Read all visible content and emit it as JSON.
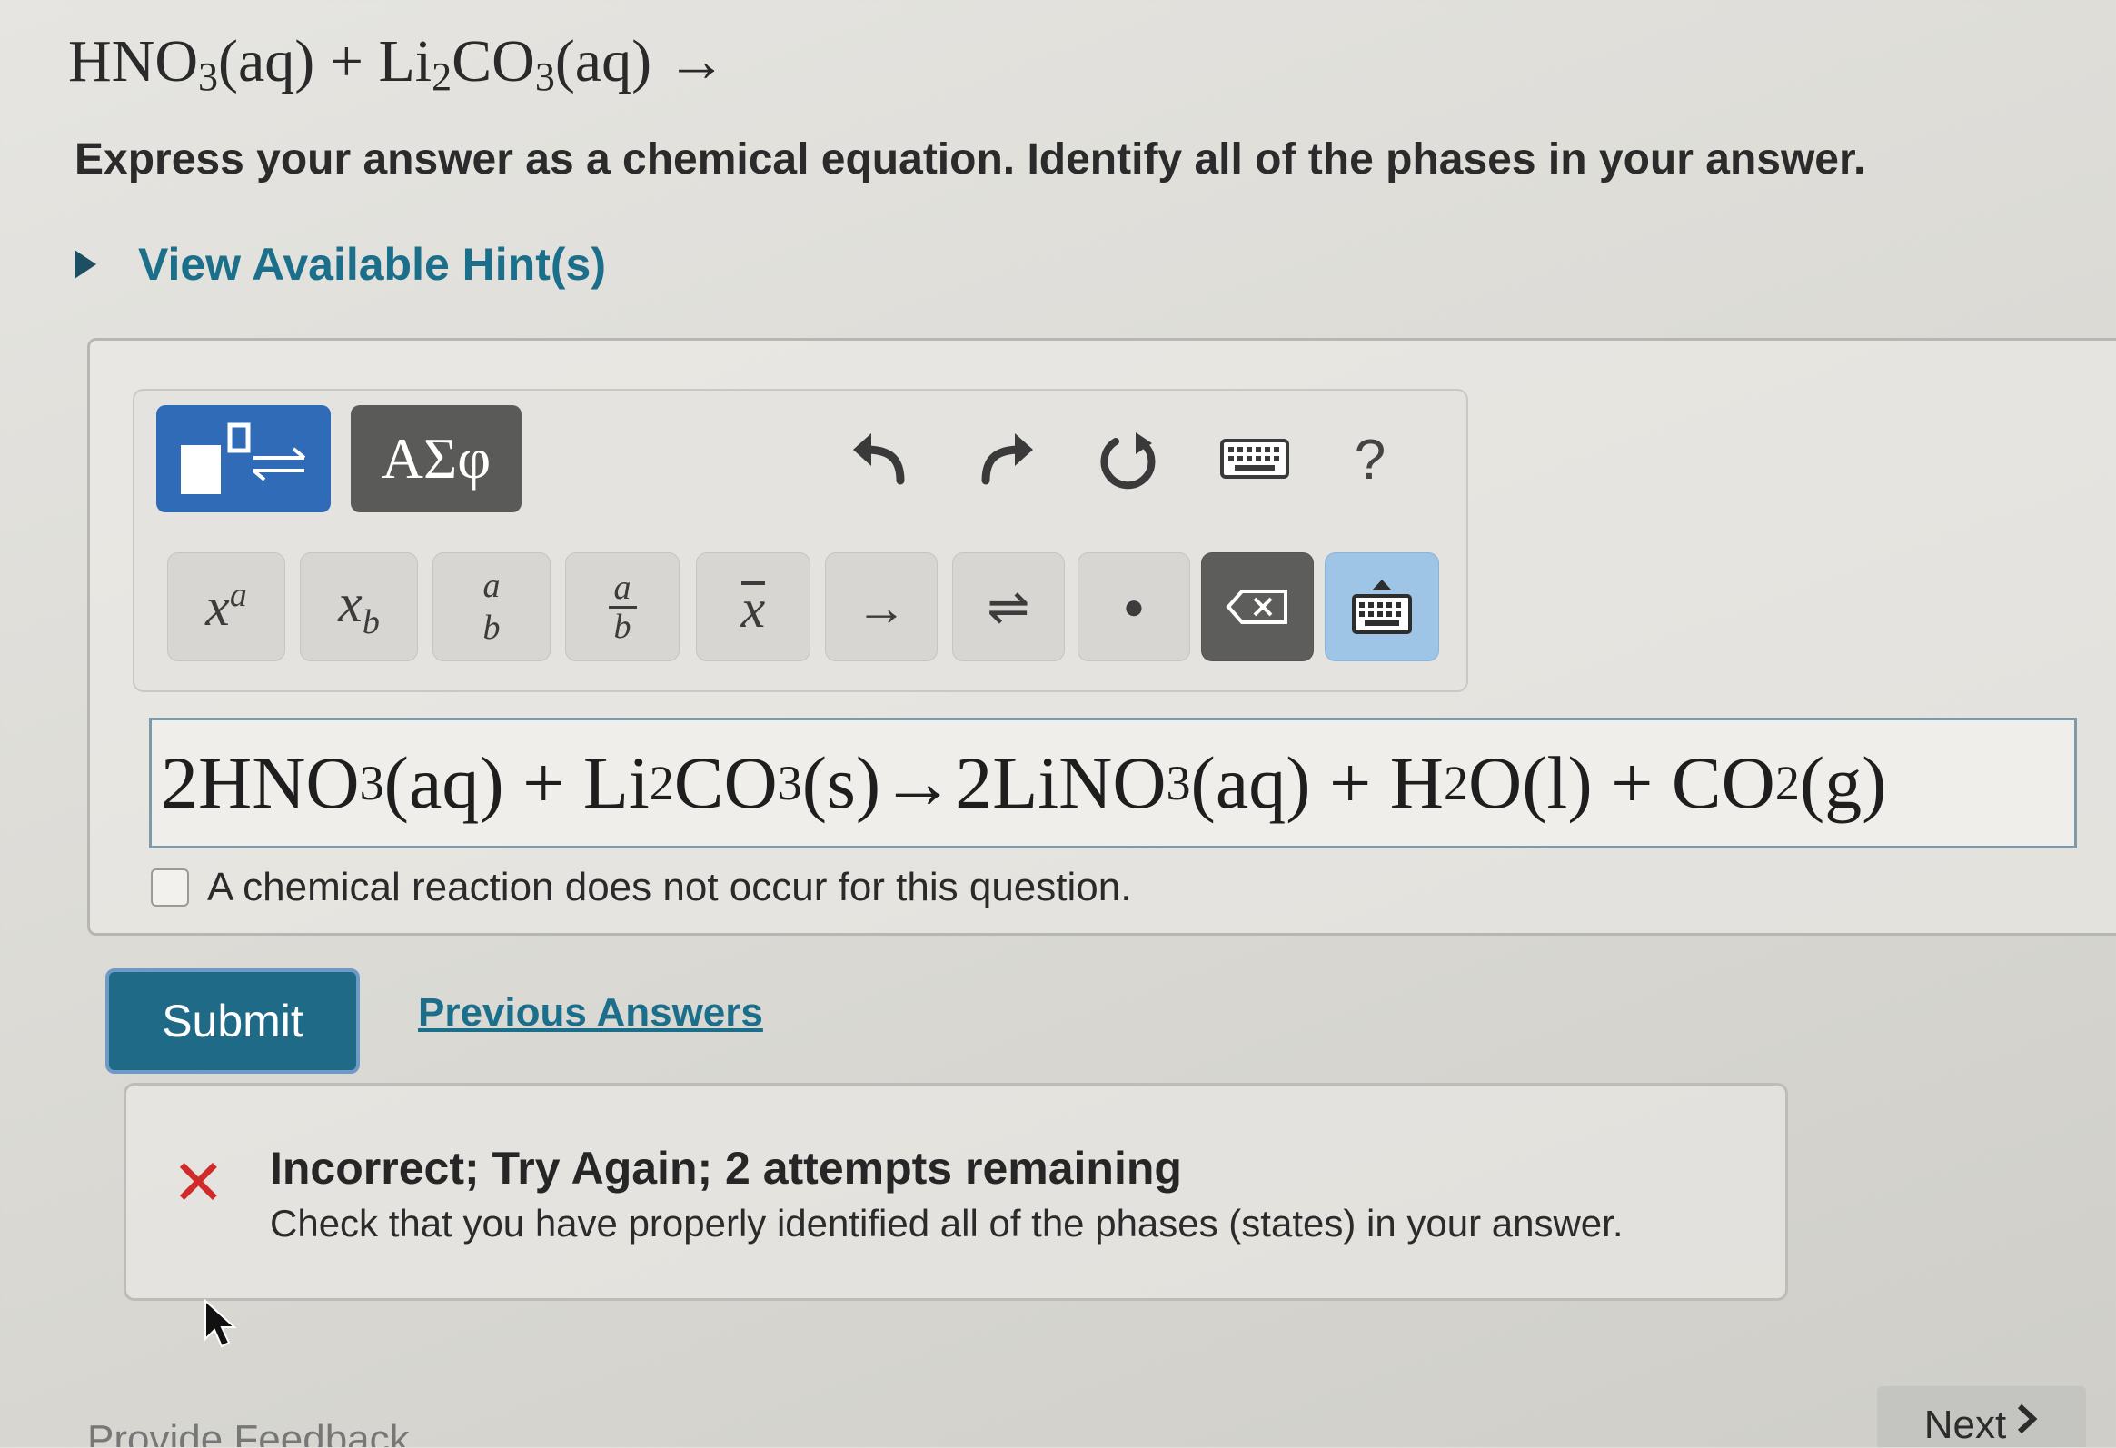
{
  "question": {
    "text": "HNO3(aq) + Li2CO3(aq) →",
    "part1": "HNO",
    "sub1": "3",
    "part2": "(aq)  +  Li",
    "sub2": "2",
    "part3": "CO",
    "sub3": "3",
    "part4": "(aq)  →"
  },
  "instruction": "Express your answer as a chemical equation. Identify all of the phases in your answer.",
  "hints_label": "View Available Hint(s)",
  "toolbar": {
    "templates_icon": "template-equilibrium-icon",
    "symbols_label": "ΑΣφ",
    "help_label": "?",
    "keys": [
      {
        "name": "superscript-key",
        "label": "x^a"
      },
      {
        "name": "subscript-key",
        "label": "x_b"
      },
      {
        "name": "fraction-key",
        "label": "a/b"
      },
      {
        "name": "stacked-fraction-key",
        "label": "a/b"
      },
      {
        "name": "overbar-key",
        "label": "x̄"
      },
      {
        "name": "reaction-arrow-key",
        "label": "→"
      },
      {
        "name": "equilibrium-arrow-key",
        "label": "⇌"
      },
      {
        "name": "dot-key",
        "label": "•"
      },
      {
        "name": "backspace-key",
        "label": "⌫"
      },
      {
        "name": "keyboard-key",
        "label": "keyboard"
      }
    ],
    "accent_color": "#2f6bb6",
    "dark_color": "#5a5a58"
  },
  "answer": {
    "t1": "2HNO",
    "s1": "3",
    "t2": "(aq) + Li",
    "s2": "2",
    "t3": "CO",
    "s3": "3",
    "t4": "(s)→2LiNO",
    "s4": "3",
    "t5": "(aq) + H",
    "s5": "2",
    "t6": "O(l) + CO",
    "s6": "2",
    "t7": "(g)"
  },
  "no_reaction_label": "A chemical reaction does not occur for this question.",
  "submit_label": "Submit",
  "previous_answers_label": "Previous Answers",
  "feedback": {
    "title": "Incorrect; Try Again; 2 attempts remaining",
    "message": "Check that you have properly identified all of the phases (states) in your answer.",
    "status_color": "#d02a2a"
  },
  "provide_feedback_label": "Provide Feedback",
  "next_label": "Next"
}
